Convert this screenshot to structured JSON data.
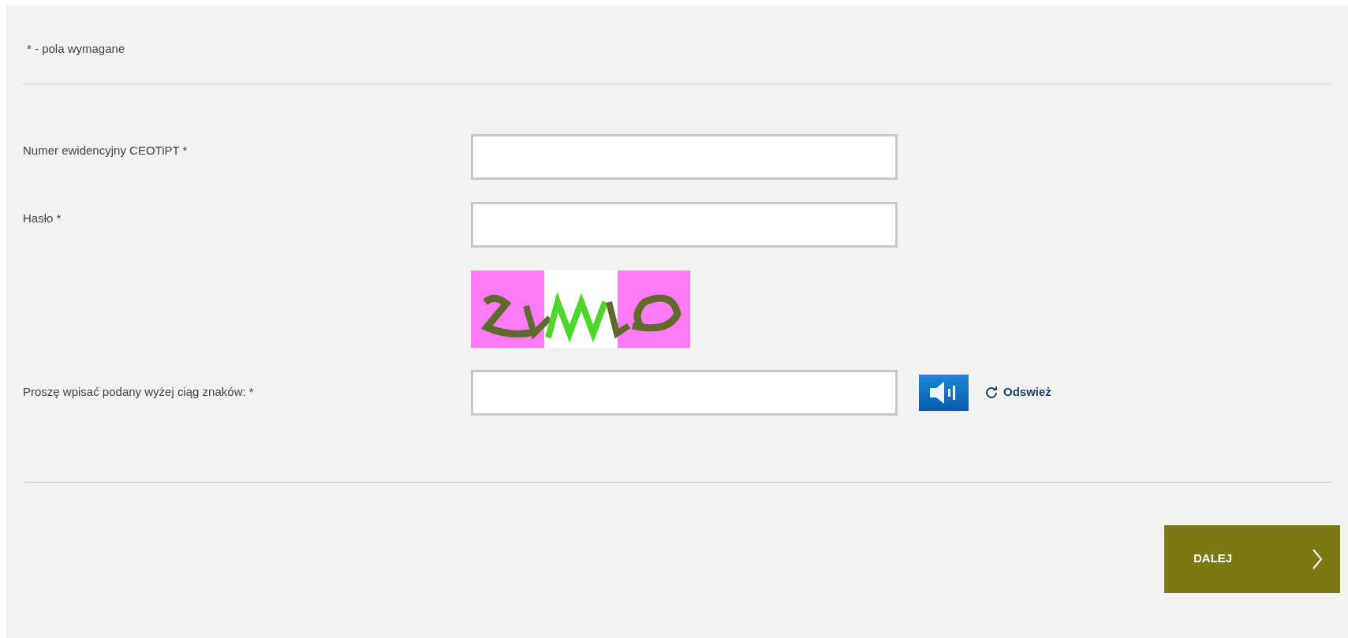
{
  "required_note": "* - pola wymagane",
  "fields": [
    {
      "kind": "text",
      "label": "Numer ewidencyjny CEOTiPT  *"
    },
    {
      "kind": "password",
      "label": "Hasło  *"
    },
    {
      "kind": "captcha",
      "label": "Proszę wpisać podany wyżej ciąg znaków: *",
      "refresh": "Odswież"
    }
  ],
  "submit": {
    "label": "DALEJ"
  }
}
